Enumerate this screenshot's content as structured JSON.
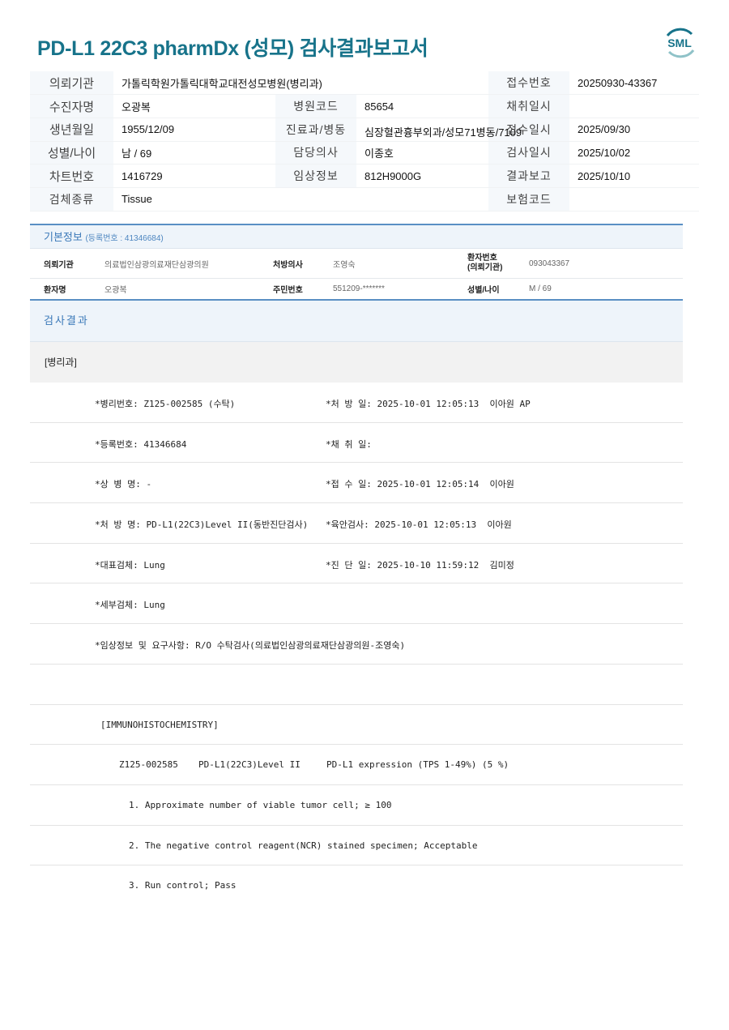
{
  "title": "PD-L1 22C3 pharmDx (성모) 검사결과보고서",
  "logo_text": "SML",
  "brand_color": "#17738a",
  "header": {
    "r1": {
      "l1": "의뢰기관",
      "v1": "가톨릭학원가톨릭대학교대전성모병원(병리과)",
      "l3": "접수번호",
      "v3": "20250930-43367"
    },
    "r2": {
      "l1": "수진자명",
      "v1": "오광복",
      "l2": "병원코드",
      "v2": "85654",
      "l3": "채취일시",
      "v3": ""
    },
    "r3": {
      "l1": "생년월일",
      "v1": "1955/12/09",
      "l2": "진료과/병동",
      "v2": "심장혈관흉부외과/성모71병동/7109",
      "l3": "접수일시",
      "v3": "2025/09/30"
    },
    "r4": {
      "l1": "성별/나이",
      "v1": "남 / 69",
      "l2": "담당의사",
      "v2": "이종호",
      "l3": "검사일시",
      "v3": "2025/10/02"
    },
    "r5": {
      "l1": "차트번호",
      "v1": "1416729",
      "l2": "임상정보",
      "v2": "812H9000G",
      "l3": "결과보고",
      "v3": "2025/10/10"
    },
    "r6": {
      "l1": "검체종류",
      "v1": "Tissue",
      "l3": "보험코드",
      "v3": ""
    }
  },
  "basic": {
    "title": "기본정보",
    "reg": "(등록번호 : 41346684)",
    "r1": {
      "k1": "의뢰기관",
      "v1": "의료법인삼광의료재단삼광의원",
      "k2": "처방의사",
      "v2": "조영숙",
      "k3a": "환자번호",
      "k3b": "(의뢰기관)",
      "v3": "093043367"
    },
    "r2": {
      "k1": "환자명",
      "v1": "오광복",
      "k2": "주민번호",
      "v2": "551209-*******",
      "k3": "성별/나이",
      "v3": "M / 69"
    }
  },
  "result": {
    "title": "검사결과",
    "dept": "[병리과]",
    "rows": [
      [
        "*병리번호: Z125-002585 (수탁)",
        "*처 방 일: 2025-10-01 12:05:13  이아원 AP"
      ],
      [
        "*등록번호: 41346684",
        "*채 취 일:"
      ],
      [
        "*상 병 명: -",
        "*접 수 일: 2025-10-01 12:05:14  이아원"
      ],
      [
        "*처 방 명: PD-L1(22C3)Level II(동반진단검사)",
        "*육안검사: 2025-10-01 12:05:13  이아원"
      ],
      [
        "*대표검체: Lung",
        "*진 단 일: 2025-10-10 11:59:12  김미정"
      ],
      [
        "*세부검체: Lung",
        ""
      ],
      [
        "*임상정보 및 요구사항: R/O 수탁검사(의료법인삼광의료재단삼광의원-조영숙)",
        ""
      ]
    ],
    "ihc_title": "[IMMUNOHISTOCHEMISTRY]",
    "ihc": {
      "id": "Z125-002585",
      "test": "PD-L1(22C3)Level II",
      "result": "PD-L1 expression (TPS 1-49%) (5 %)"
    },
    "items": [
      "1. Approximate number of viable tumor cell; ≥ 100",
      "2. The negative control reagent(NCR) stained specimen; Acceptable",
      "3. Run control; Pass"
    ]
  }
}
